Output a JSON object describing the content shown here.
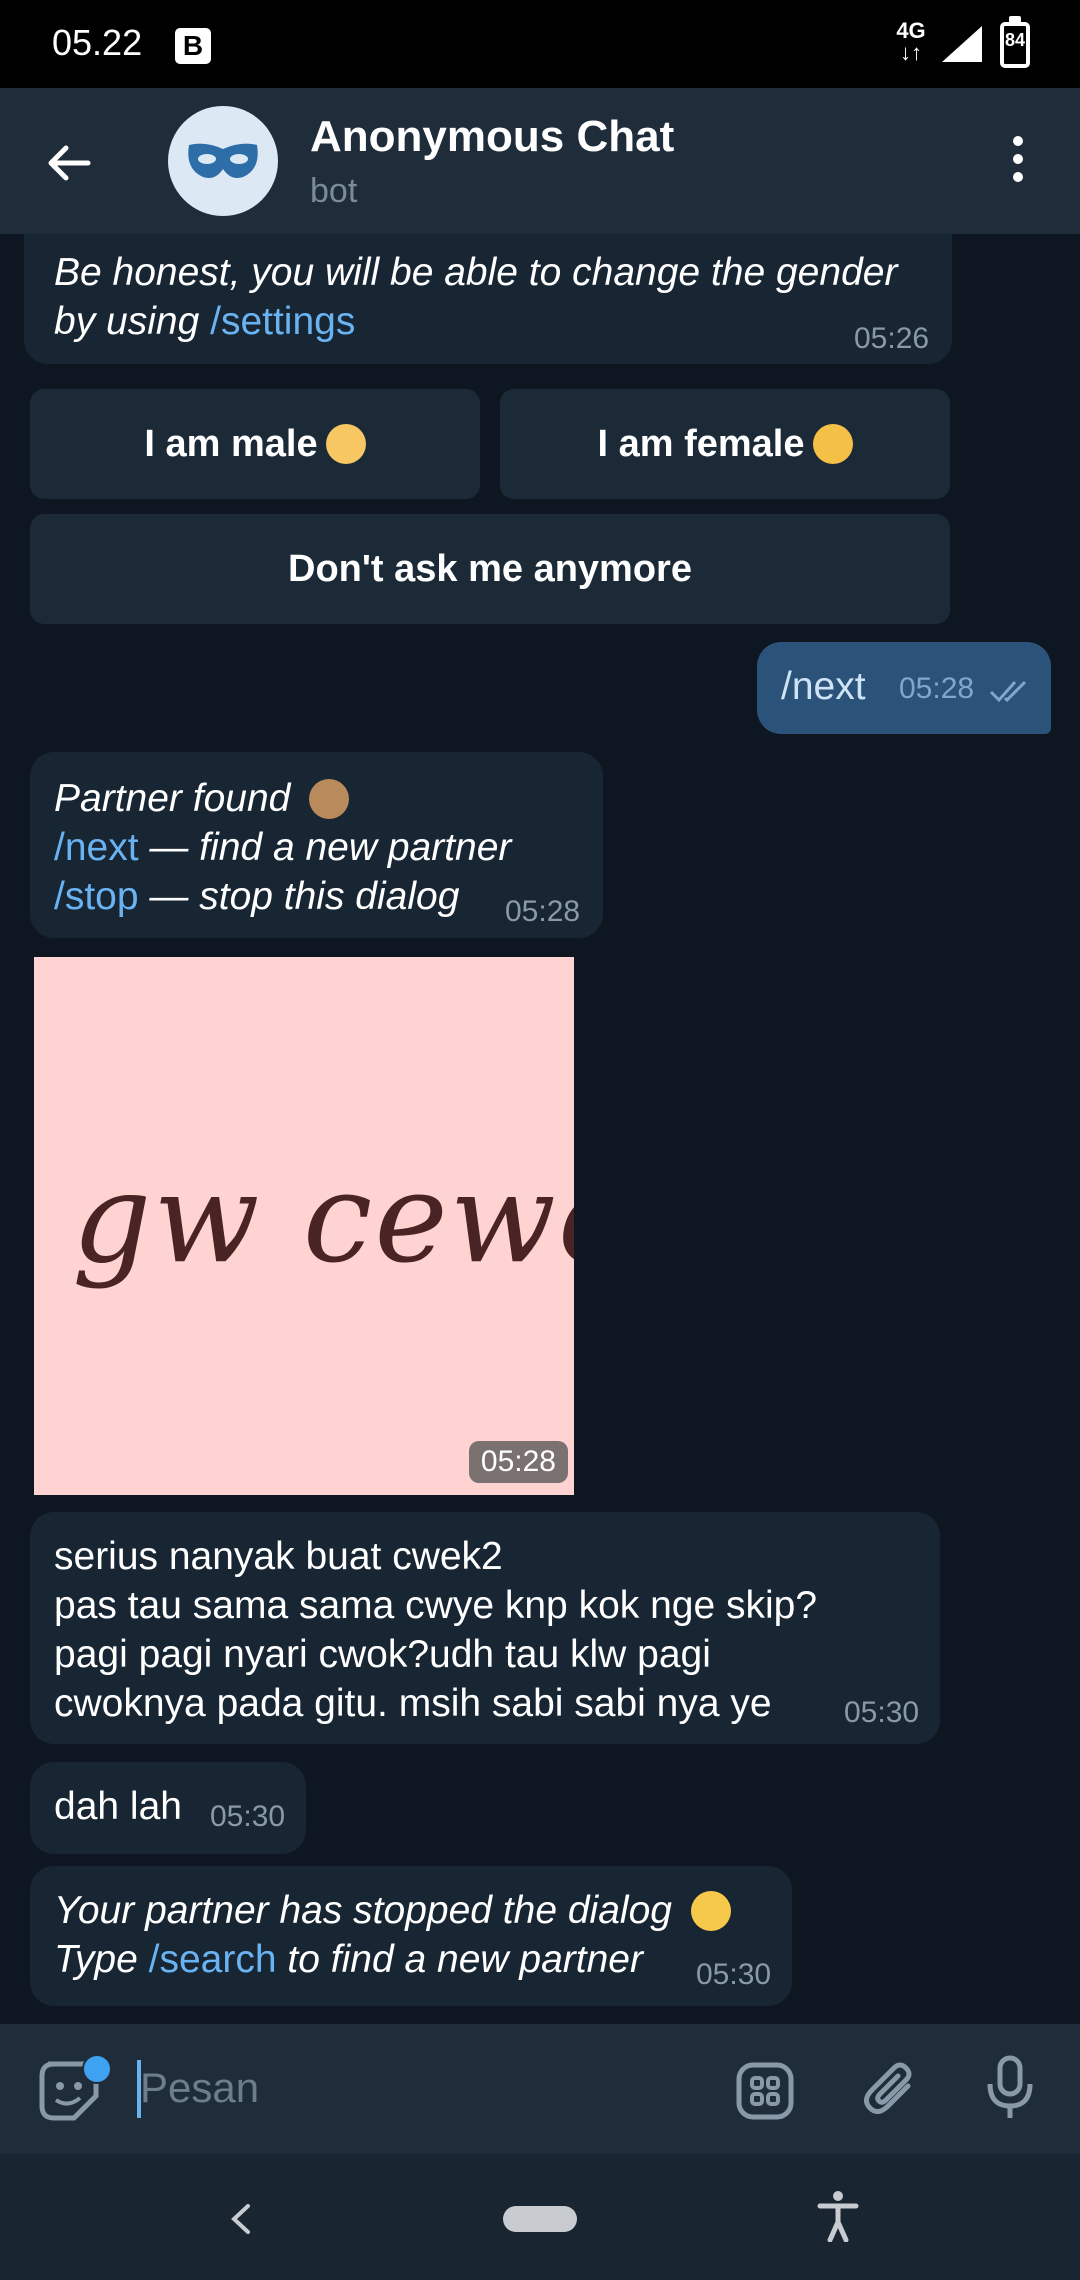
{
  "status_bar": {
    "time": "05.22",
    "app_badge": "B",
    "network": "4G",
    "battery": "84"
  },
  "header": {
    "title": "Anonymous Chat",
    "subtitle": "bot",
    "icons": [
      "back-arrow-icon",
      "mask-icon",
      "more-vert-icon"
    ]
  },
  "messages": [
    {
      "id": "m1",
      "lines": [
        "Be honest, you will be able to change the gender",
        "by using"
      ],
      "link": "/settings",
      "time": "05:26"
    },
    {
      "id": "m2",
      "text": "/next",
      "time": "05:28",
      "outgoing": true
    },
    {
      "id": "m3",
      "line1": "Partner found",
      "cmd1": "/next",
      "desc1": " — find a new partner",
      "cmd2": "/stop",
      "desc2": " — stop this dialog",
      "time": "05:28"
    },
    {
      "id": "m4",
      "photo_text": "gw cewe",
      "time": "05:28"
    },
    {
      "id": "m5",
      "lines": [
        "serius nanyak buat cwek2",
        "pas tau sama sama cwye knp kok nge skip?",
        "pagi pagi nyari cwok?udh tau klw pagi",
        "cwoknya pada gitu. msih sabi sabi nya ye"
      ],
      "time": "05:30"
    },
    {
      "id": "m6",
      "text": "dah lah",
      "time": "05:30"
    },
    {
      "id": "m7",
      "line1": "Your partner has stopped the dialog",
      "pre2": "Type ",
      "cmd": "/search",
      "post2": " to find a new partner",
      "time": "05:30"
    }
  ],
  "keyboard": {
    "male": "I am male",
    "female": "I am female",
    "no_ask": "Don't ask me anymore"
  },
  "input": {
    "placeholder": "Pesan"
  },
  "colors": {
    "bg": "#0e1621",
    "header": "#1f2c3a",
    "incoming": "#182533",
    "outgoing": "#2b5278",
    "link": "#6ab3f3"
  }
}
